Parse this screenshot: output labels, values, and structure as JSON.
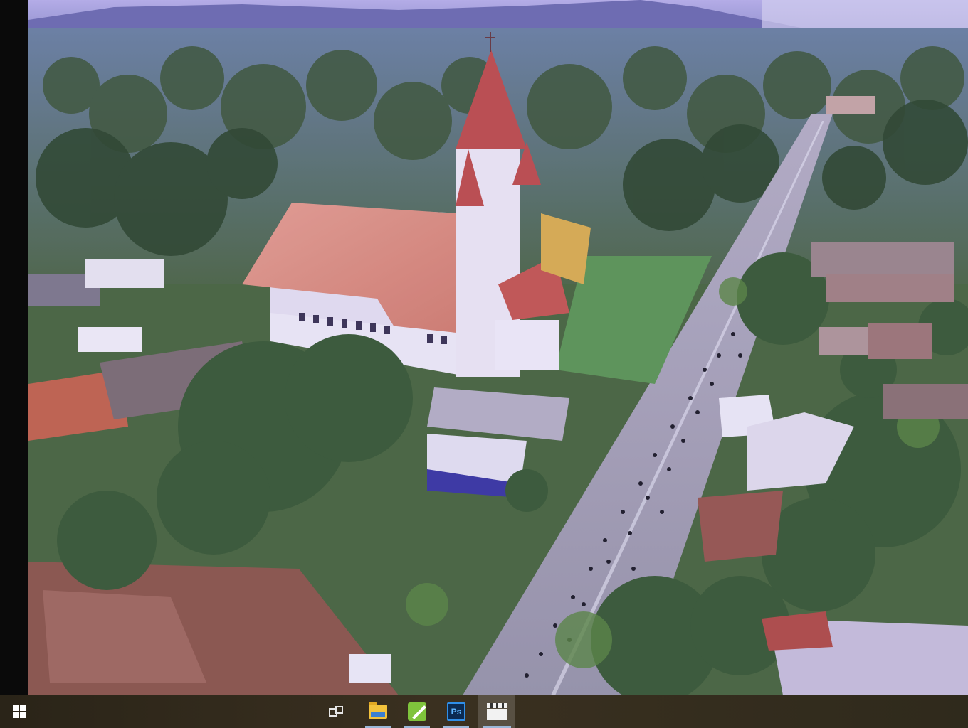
{
  "colors": {
    "taskbar_bg": "#2f2a1c",
    "taskbar_active_indicator": "#9ab7d8",
    "side_bar": "#0a0a0a"
  },
  "viewer": {
    "content": "aerial-church-street-photo"
  },
  "taskbar": {
    "start_icon": "windows-logo-icon",
    "items": [
      {
        "icon": "task-view-icon",
        "active": false,
        "current": false
      },
      {
        "icon": "file-explorer-folder-icon",
        "active": true,
        "current": false
      },
      {
        "icon": "green-app-icon",
        "active": true,
        "current": false
      },
      {
        "icon": "photoshop-icon",
        "label": "Ps",
        "active": true,
        "current": false
      },
      {
        "icon": "video-editor-clapper-icon",
        "active": true,
        "current": true
      }
    ]
  }
}
